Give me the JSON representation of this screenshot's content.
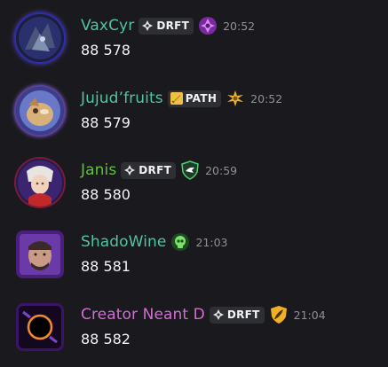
{
  "messages": [
    {
      "username": "VaxCyr",
      "name_color": "#4fc3a5",
      "tag": {
        "icon": "diamond-icon",
        "label": "DRFT"
      },
      "badge": "purple-gem-icon",
      "time": "20:52",
      "text": "88 578"
    },
    {
      "username": "Jujud’fruits",
      "name_color": "#4fc3a5",
      "tag": {
        "icon": "sword-icon",
        "label": "PATH"
      },
      "badge": "golden-wing-icon",
      "time": "20:52",
      "text": "88 579"
    },
    {
      "username": "Janis",
      "name_color": "#5ec23a",
      "tag": {
        "icon": "diamond-icon",
        "label": "DRFT"
      },
      "badge": "shield-bird-icon",
      "time": "20:59",
      "text": "88 580"
    },
    {
      "username": "ShadoWine",
      "name_color": "#4fc3a5",
      "tag": null,
      "badge": "skull-icon",
      "time": "21:03",
      "text": "88 581"
    },
    {
      "username": "Creator Neant D",
      "name_color": "#cf6fcf",
      "tag": {
        "icon": "diamond-icon",
        "label": "DRFT"
      },
      "badge": "gold-feather-icon",
      "time": "21:04",
      "text": "88 582"
    }
  ]
}
